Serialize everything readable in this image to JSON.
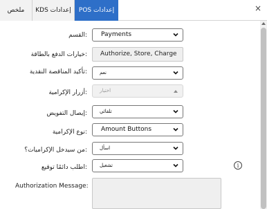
{
  "tabs": [
    {
      "label": "POS إعدادات",
      "active": true
    },
    {
      "label": "KDS إعدادات",
      "active": false
    },
    {
      "label": "ملخص",
      "active": false
    }
  ],
  "close_icon": "×",
  "info_icon": "i",
  "colors": {
    "accent": "#2e6fc8",
    "disabled_bg": "#efefef"
  },
  "form": {
    "section": {
      "label": ":القسم",
      "value": "Payments"
    },
    "card_payment_options": {
      "label": ":خيارات الدفع بالطاقة",
      "value": "Authorize, Store, Charge"
    },
    "confirm_cash_tender": {
      "label": ":تأكيد المناقصة النقدية",
      "value": "نعم"
    },
    "tip_buttons": {
      "label": ":أزرار الإكرامية",
      "value": "اختيار"
    },
    "auth_receipt": {
      "label": ":إيصال التفويض",
      "value": "تلقائي"
    },
    "tip_type": {
      "label": ":نوع الإكرامية",
      "value": "Amount Buttons"
    },
    "tip_entry": {
      "label": ":من سيدخل الإكراميات؟",
      "value": "اسأل"
    },
    "always_signature": {
      "label": ":اطلب دائمًا توقيع",
      "value": "تشغيل"
    },
    "authorization_message": {
      "label": "Authorization Message:",
      "value": ""
    }
  }
}
